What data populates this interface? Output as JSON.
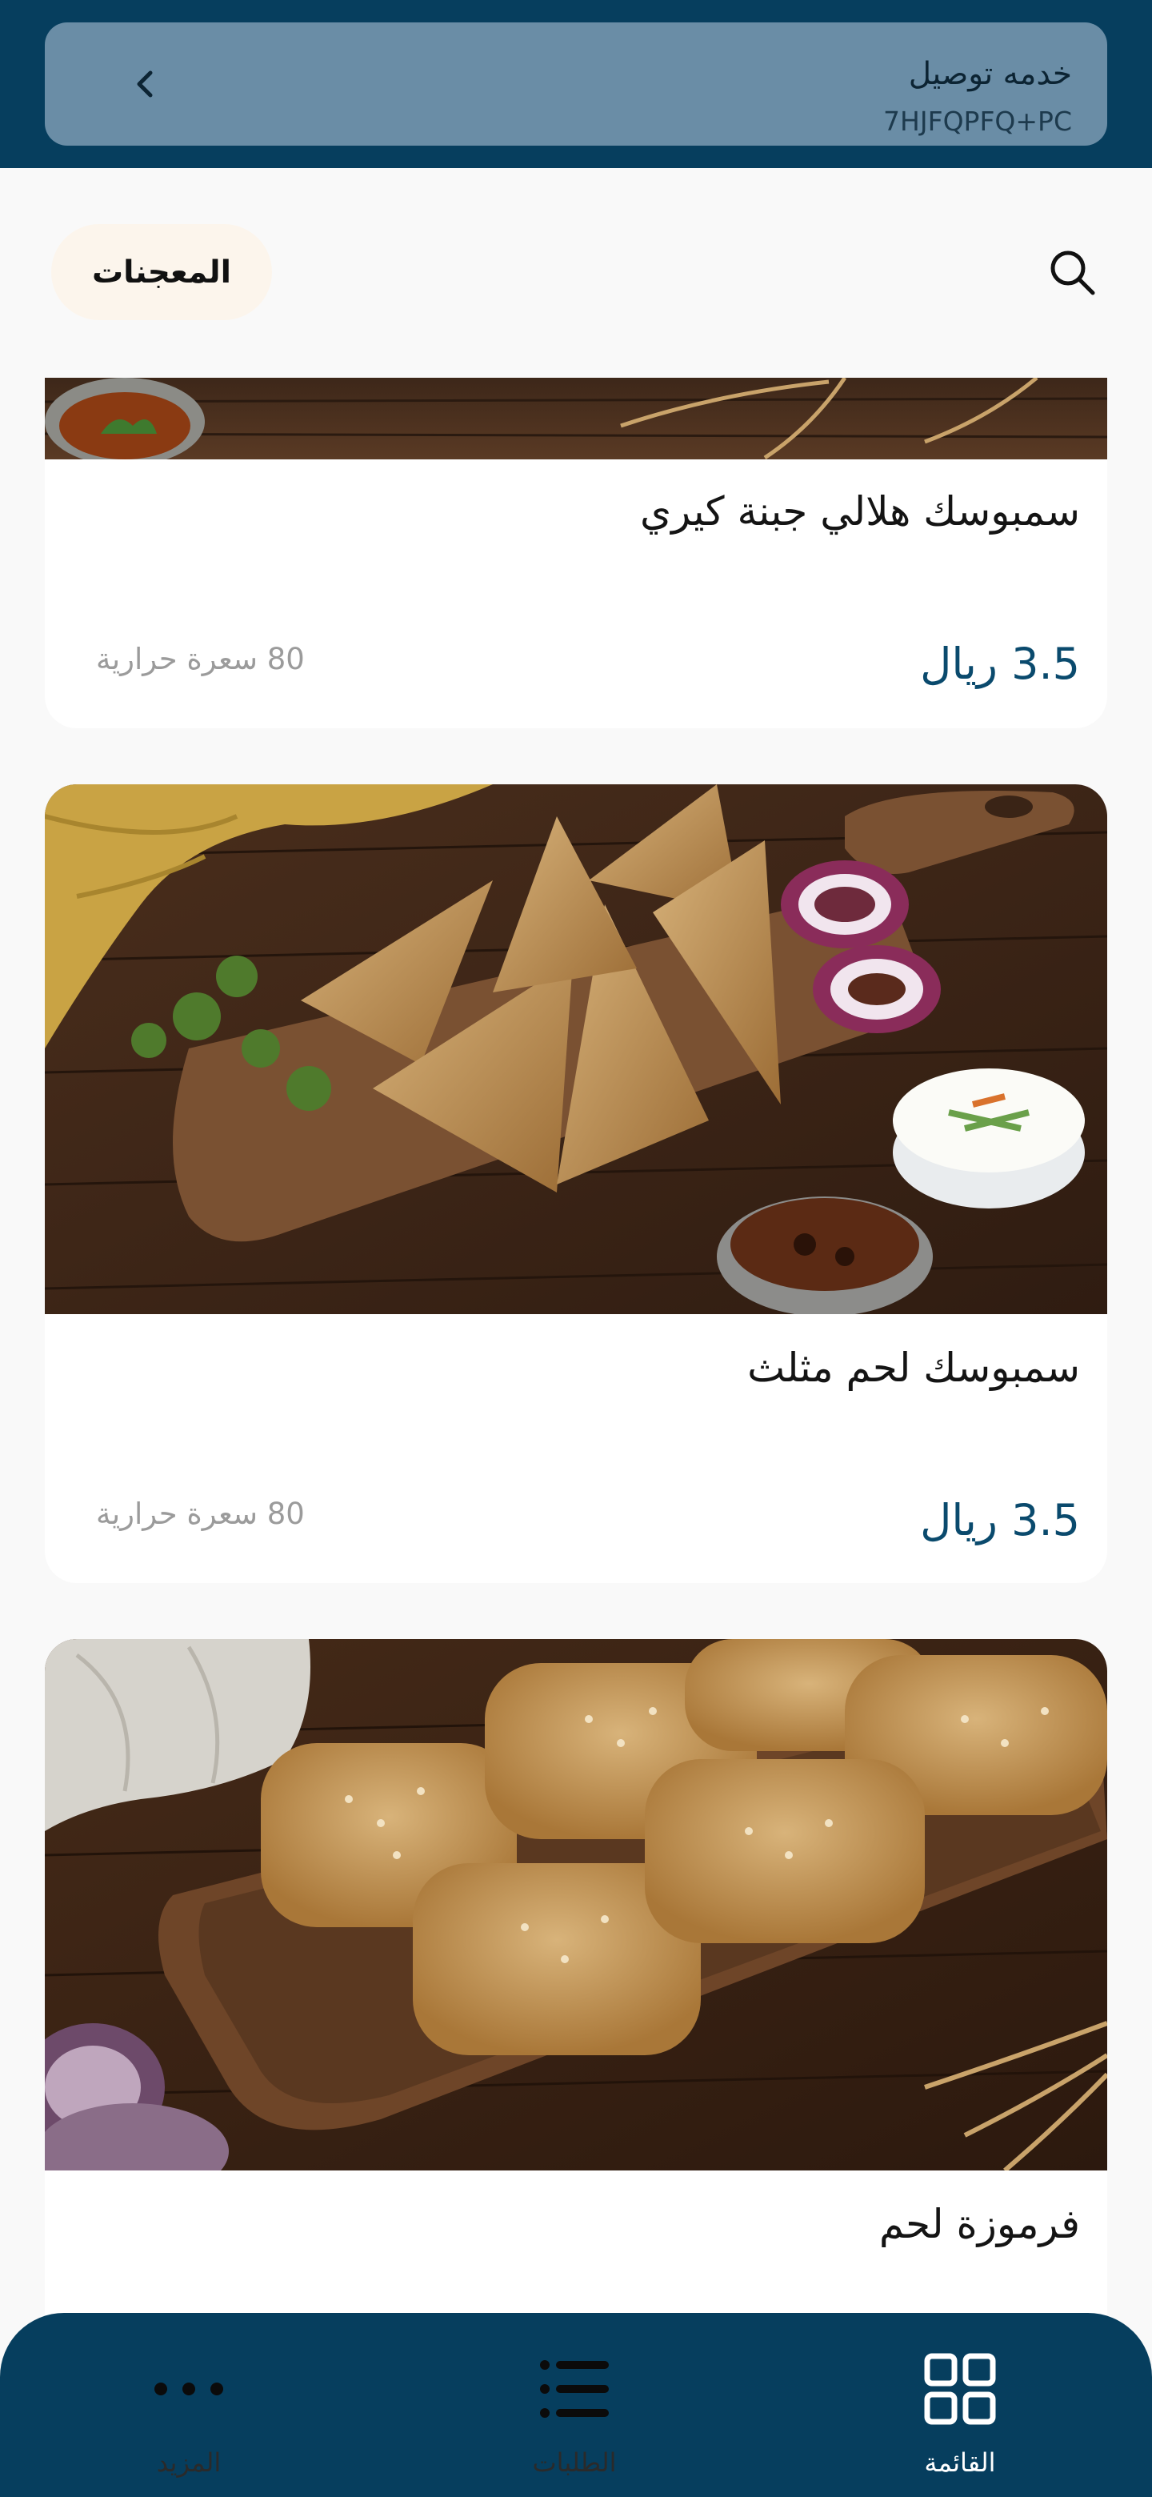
{
  "header": {
    "service_title": "خدمه توصيل",
    "location_code": "7HJFQPFQ+PC"
  },
  "filter": {
    "category_chip": "المعجنات"
  },
  "items": [
    {
      "name": "سمبوسك هلالي جبنة كيري",
      "price": "3.5 ريال",
      "calories": "80 سعرة حرارية"
    },
    {
      "name": "سمبوسك لحم مثلث",
      "price": "3.5 ريال",
      "calories": "80 سعرة حرارية"
    },
    {
      "name": "فرموزة لحم"
    }
  ],
  "bottom_nav": {
    "menu_label": "القائمة",
    "orders_label": "الطلبات",
    "more_label": "المزيد"
  },
  "colors": {
    "primary": "#063e5e",
    "price": "#0a4a6d",
    "chip_bg": "#fcf5ec"
  }
}
